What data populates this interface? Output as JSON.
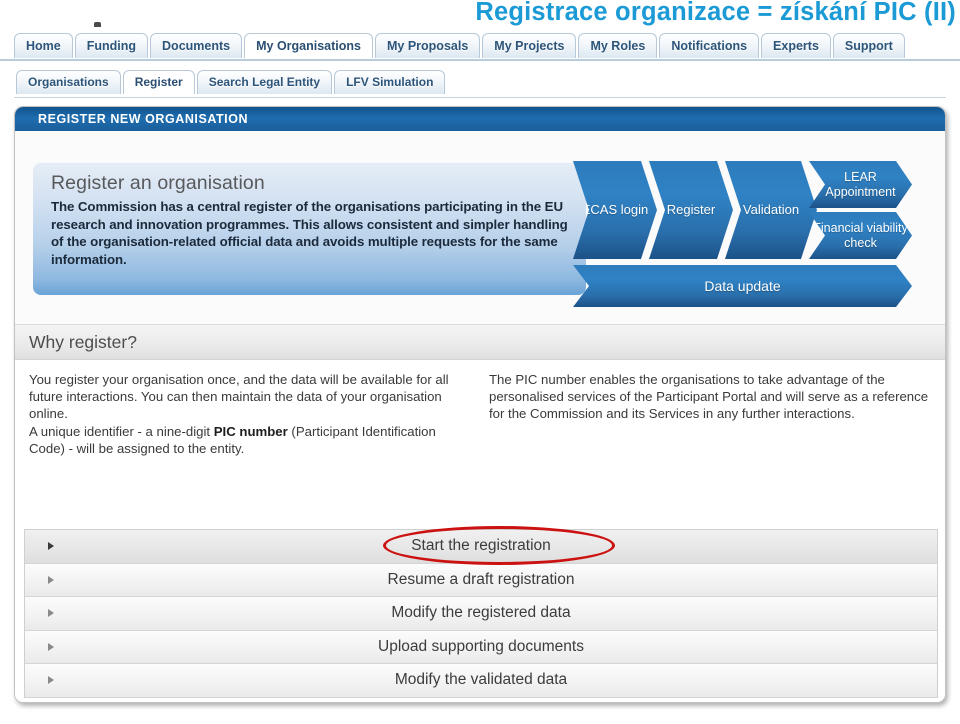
{
  "slide": {
    "title": "Registrace organizace = získání PIC (II)",
    "title_color": "#1b9ad6"
  },
  "nav": {
    "main_tabs": [
      {
        "label": "Home",
        "active": false
      },
      {
        "label": "Funding",
        "active": false
      },
      {
        "label": "Documents",
        "active": false
      },
      {
        "label": "My Organisations",
        "active": true
      },
      {
        "label": "My Proposals",
        "active": false
      },
      {
        "label": "My Projects",
        "active": false
      },
      {
        "label": "My Roles",
        "active": false
      },
      {
        "label": "Notifications",
        "active": false
      },
      {
        "label": "Experts",
        "active": false
      },
      {
        "label": "Support",
        "active": false
      }
    ],
    "sub_tabs": [
      {
        "label": "Organisations",
        "active": false
      },
      {
        "label": "Register",
        "active": true
      },
      {
        "label": "Search Legal Entity",
        "active": false
      },
      {
        "label": "LFV Simulation",
        "active": false
      }
    ]
  },
  "panel": {
    "header": "REGISTER NEW ORGANISATION",
    "intro": {
      "heading": "Register an organisation",
      "body": "The Commission has a central register of the organisations participating in the EU research and innovation programmes. This allows consistent and simpler handling of the organisation-related official data and avoids multiple requests for the same information."
    },
    "flow": {
      "steps": [
        {
          "label": "ECAS login"
        },
        {
          "label": "Register"
        },
        {
          "label": "Validation"
        },
        {
          "label": "LEAR Appointment"
        },
        {
          "label": "Financial viability check"
        },
        {
          "label": "Data update"
        }
      ],
      "color": "#2a6fac"
    },
    "why": {
      "heading": "Why register?",
      "left_p1": "You register your organisation once, and the data will be available for all future interactions. You can then maintain the data of your organisation online.",
      "left_p2_before": "A unique identifier - a nine-digit ",
      "left_p2_bold": "PIC number",
      "left_p2_after": " (Participant Identification Code) - will be assigned to the entity.",
      "right_p1": "The PIC number enables the organisations to take advantage of the personalised services of the Participant Portal and will serve as a reference for the Commission and its Services in any further interactions."
    },
    "actions": [
      {
        "label": "Start the registration",
        "highlighted": true
      },
      {
        "label": "Resume a draft registration",
        "highlighted": false
      },
      {
        "label": "Modify the registered data",
        "highlighted": false
      },
      {
        "label": "Upload supporting documents",
        "highlighted": false
      },
      {
        "label": "Modify the validated data",
        "highlighted": false
      }
    ]
  },
  "annotation": {
    "shape": "ellipse",
    "color": "#cc1111",
    "targets": "Start the registration"
  }
}
